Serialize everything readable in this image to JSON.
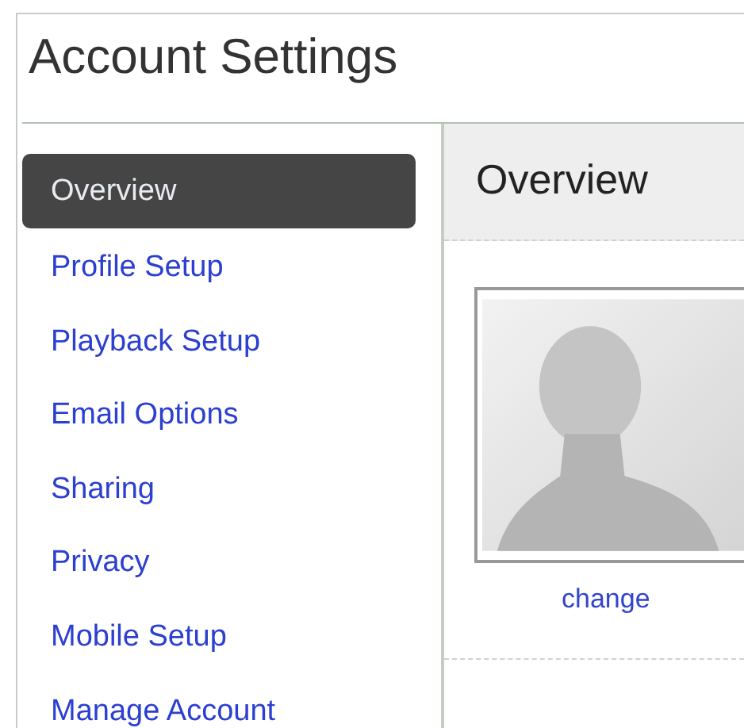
{
  "title": "Account Settings",
  "sidebar": {
    "items": [
      {
        "label": "Overview",
        "selected": true
      },
      {
        "label": "Profile Setup",
        "selected": false
      },
      {
        "label": "Playback Setup",
        "selected": false
      },
      {
        "label": "Email Options",
        "selected": false
      },
      {
        "label": "Sharing",
        "selected": false
      },
      {
        "label": "Privacy",
        "selected": false
      },
      {
        "label": "Mobile Setup",
        "selected": false
      },
      {
        "label": "Manage Account",
        "selected": false
      }
    ]
  },
  "panel": {
    "heading": "Overview",
    "avatar_link": "change"
  }
}
